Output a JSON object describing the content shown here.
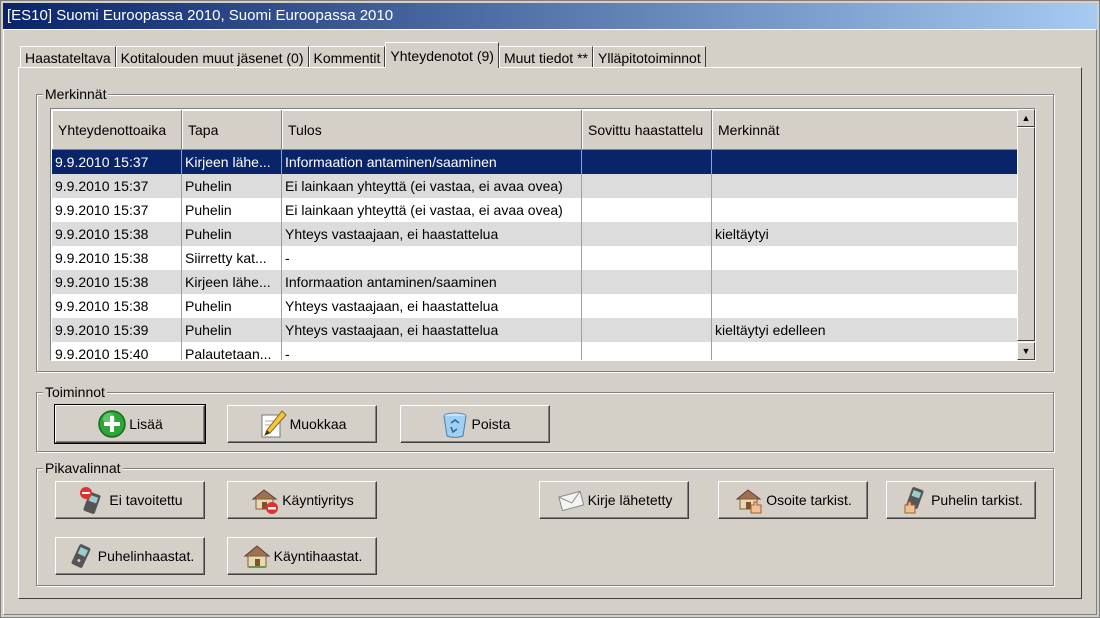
{
  "window": {
    "title": "[ES10] Suomi Euroopassa 2010, Suomi Euroopassa 2010"
  },
  "tabs": [
    {
      "label": "Haastateltava"
    },
    {
      "label": "Kotitalouden muut jäsenet (0)"
    },
    {
      "label": "Kommentit"
    },
    {
      "label": "Yhteydenotot (9)",
      "active": true
    },
    {
      "label": "Muut tiedot **"
    },
    {
      "label": "Ylläpitotoiminnot"
    }
  ],
  "merkinnat": {
    "legend": "Merkinnät",
    "columns": [
      "Yhteydenottoaika",
      "Tapa",
      "Tulos",
      "Sovittu haastattelu",
      "Merkinnät"
    ],
    "rows": [
      {
        "time": "9.9.2010 15:37",
        "method": "Kirjeen lähe...",
        "result": "Informaation antaminen/saaminen",
        "agreed": "",
        "notes": ""
      },
      {
        "time": "9.9.2010 15:37",
        "method": "Puhelin",
        "result": "Ei lainkaan yhteyttä (ei vastaa, ei avaa ovea)",
        "agreed": "",
        "notes": ""
      },
      {
        "time": "9.9.2010 15:37",
        "method": "Puhelin",
        "result": "Ei lainkaan yhteyttä (ei vastaa, ei avaa ovea)",
        "agreed": "",
        "notes": ""
      },
      {
        "time": "9.9.2010 15:38",
        "method": "Puhelin",
        "result": "Yhteys vastaajaan, ei haastattelua",
        "agreed": "",
        "notes": "kieltäytyi"
      },
      {
        "time": "9.9.2010 15:38",
        "method": "Siirretty kat...",
        "result": "-",
        "agreed": "",
        "notes": ""
      },
      {
        "time": "9.9.2010 15:38",
        "method": "Kirjeen lähe...",
        "result": "Informaation antaminen/saaminen",
        "agreed": "",
        "notes": ""
      },
      {
        "time": "9.9.2010 15:38",
        "method": "Puhelin",
        "result": "Yhteys vastaajaan, ei haastattelua",
        "agreed": "",
        "notes": ""
      },
      {
        "time": "9.9.2010 15:39",
        "method": "Puhelin",
        "result": "Yhteys vastaajaan, ei haastattelua",
        "agreed": "",
        "notes": "kieltäytyi edelleen"
      },
      {
        "time": "9.9.2010 15:40",
        "method": "Palautetaan...",
        "result": "-",
        "agreed": "",
        "notes": ""
      }
    ]
  },
  "toiminnot": {
    "legend": "Toiminnot",
    "add": "Lisää",
    "edit": "Muokkaa",
    "delete": "Poista"
  },
  "pikavalinnat": {
    "legend": "Pikavalinnat",
    "not_reached": "Ei tavoitettu",
    "visit_attempt": "Käyntiyritys",
    "letter_sent": "Kirje lähetetty",
    "address_check": "Osoite tarkist.",
    "phone_check": "Puhelin tarkist.",
    "phone_interview": "Puhelinhaastat.",
    "visit_interview": "Käyntihaastat."
  },
  "icons": {
    "add": "plus-circle-icon",
    "edit": "pencil-note-icon",
    "delete": "recycle-bin-icon",
    "phone": "mobile-phone-icon",
    "house": "house-icon",
    "letter": "envelope-icon"
  },
  "colors": {
    "selection": "#0a246a",
    "titlebar_start": "#0a246a",
    "titlebar_end": "#a6caf0",
    "window_bg": "#d4d0c8"
  }
}
